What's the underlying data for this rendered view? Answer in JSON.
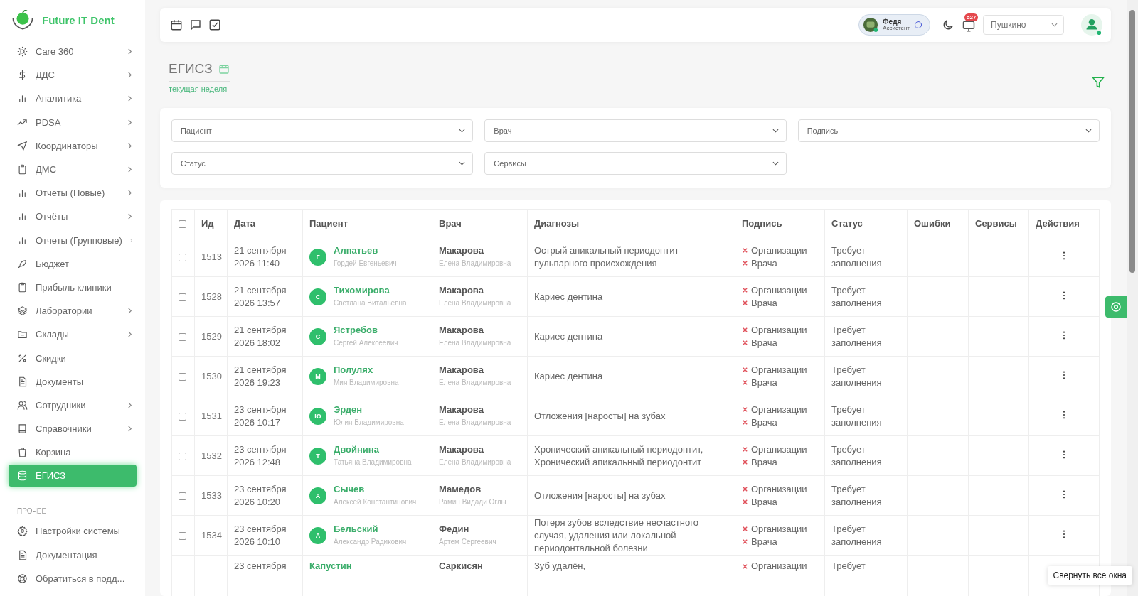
{
  "brand": "Future IT Dent",
  "sidebar": {
    "items": [
      {
        "label": "Care 360",
        "expandable": true,
        "selected": false
      },
      {
        "label": "ДДС",
        "expandable": true,
        "selected": false
      },
      {
        "label": "Аналитика",
        "expandable": true,
        "selected": false
      },
      {
        "label": "PDSA",
        "expandable": true,
        "selected": false
      },
      {
        "label": "Координаторы",
        "expandable": true,
        "selected": false
      },
      {
        "label": "ДМС",
        "expandable": true,
        "selected": false
      },
      {
        "label": "Отчеты (Новые)",
        "expandable": true,
        "selected": false
      },
      {
        "label": "Отчёты",
        "expandable": true,
        "selected": false
      },
      {
        "label": "Отчеты (Групповые)",
        "expandable": true,
        "selected": false
      },
      {
        "label": "Бюджет",
        "expandable": false,
        "selected": false
      },
      {
        "label": "Прибыль клиники",
        "expandable": false,
        "selected": false
      },
      {
        "label": "Лаборатории",
        "expandable": true,
        "selected": false
      },
      {
        "label": "Склады",
        "expandable": true,
        "selected": false
      },
      {
        "label": "Скидки",
        "expandable": false,
        "selected": false
      },
      {
        "label": "Документы",
        "expandable": false,
        "selected": false
      },
      {
        "label": "Сотрудники",
        "expandable": true,
        "selected": false
      },
      {
        "label": "Справочники",
        "expandable": true,
        "selected": false
      },
      {
        "label": "Корзина",
        "expandable": false,
        "selected": false
      },
      {
        "label": "ЕГИСЗ",
        "expandable": false,
        "selected": true
      }
    ],
    "section": "ПРОЧЕЕ",
    "other_items": [
      {
        "label": "Настройки системы"
      },
      {
        "label": "Документация"
      },
      {
        "label": "Обратиться в подд..."
      }
    ]
  },
  "topbar": {
    "assistant": {
      "name": "Федя",
      "role": "Ассистент"
    },
    "notifications": "527",
    "clinic": "Пушкино"
  },
  "page": {
    "title": "ЕГИСЗ",
    "period": "текущая неделя"
  },
  "filters": [
    {
      "placeholder": "Пациент"
    },
    {
      "placeholder": "Врач"
    },
    {
      "placeholder": "Подпись"
    },
    {
      "placeholder": "Статус"
    },
    {
      "placeholder": "Сервисы"
    }
  ],
  "table": {
    "all_checked": false,
    "columns": [
      "Ид",
      "Дата",
      "Пациент",
      "Врач",
      "Диагнозы",
      "Подпись",
      "Статус",
      "Ошибки",
      "Сервисы",
      "Действия"
    ],
    "rows": [
      {
        "checked": false,
        "id": "1513",
        "date": [
          "21 сентября",
          "2026 11:40"
        ],
        "initial": "Г",
        "patient": "Алпатьев",
        "patient_sub": "Гордей Евгеньевич",
        "doctor": "Макарова",
        "doctor_sub": "Елена Владимировна",
        "diagnosis": [
          "Острый апикальный периодонтит",
          "пульпарного происхождения"
        ],
        "signature": [
          "Организации",
          "Врача"
        ],
        "status": [
          "Требует",
          "заполнения"
        ]
      },
      {
        "checked": false,
        "id": "1528",
        "date": [
          "21 сентября",
          "2026 13:57"
        ],
        "initial": "С",
        "patient": "Тихомирова",
        "patient_sub": "Светлана Витальевна",
        "doctor": "Макарова",
        "doctor_sub": "Елена Владимировна",
        "diagnosis": [
          "Кариес дентина"
        ],
        "signature": [
          "Организации",
          "Врача"
        ],
        "status": [
          "Требует",
          "заполнения"
        ]
      },
      {
        "checked": false,
        "id": "1529",
        "date": [
          "21 сентября",
          "2026 18:02"
        ],
        "initial": "С",
        "patient": "Ястребов",
        "patient_sub": "Сергей Алексеевич",
        "doctor": "Макарова",
        "doctor_sub": "Елена Владимировна",
        "diagnosis": [
          "Кариес дентина"
        ],
        "signature": [
          "Организации",
          "Врача"
        ],
        "status": [
          "Требует",
          "заполнения"
        ]
      },
      {
        "checked": false,
        "id": "1530",
        "date": [
          "21 сентября",
          "2026 19:23"
        ],
        "initial": "М",
        "patient": "Полулях",
        "patient_sub": "Мия Владимировна",
        "doctor": "Макарова",
        "doctor_sub": "Елена Владимировна",
        "diagnosis": [
          "Кариес дентина"
        ],
        "signature": [
          "Организации",
          "Врача"
        ],
        "status": [
          "Требует",
          "заполнения"
        ]
      },
      {
        "checked": false,
        "id": "1531",
        "date": [
          "23 сентября",
          "2026 10:17"
        ],
        "initial": "Ю",
        "patient": "Эрден",
        "patient_sub": "Юлия Владимировна",
        "doctor": "Макарова",
        "doctor_sub": "Елена Владимировна",
        "diagnosis": [
          "Отложения [наросты] на зубах"
        ],
        "signature": [
          "Организации",
          "Врача"
        ],
        "status": [
          "Требует",
          "заполнения"
        ]
      },
      {
        "checked": false,
        "id": "1532",
        "date": [
          "23 сентября",
          "2026 12:48"
        ],
        "initial": "Т",
        "patient": "Двойнина",
        "patient_sub": "Татьяна Владимировна",
        "doctor": "Макарова",
        "doctor_sub": "Елена Владимировна",
        "diagnosis": [
          "Хронический апикальный периодонтит,",
          "Хронический апикальный периодонтит"
        ],
        "signature": [
          "Организации",
          "Врача"
        ],
        "status": [
          "Требует",
          "заполнения"
        ]
      },
      {
        "checked": false,
        "id": "1533",
        "date": [
          "23 сентября",
          "2026 10:20"
        ],
        "initial": "А",
        "patient": "Сычев",
        "patient_sub": "Алексей Константинович",
        "doctor": "Мамедов",
        "doctor_sub": "Рамин Видади Оглы",
        "diagnosis": [
          "Отложения [наросты] на зубах"
        ],
        "signature": [
          "Организации",
          "Врача"
        ],
        "status": [
          "Требует",
          "заполнения"
        ]
      },
      {
        "checked": false,
        "id": "1534",
        "date": [
          "23 сентября",
          "2026 10:10"
        ],
        "initial": "А",
        "patient": "Бельский",
        "patient_sub": "Александр Радикович",
        "doctor": "Федин",
        "doctor_sub": "Артем Сергеевич",
        "diagnosis": [
          "Потеря зубов вследствие несчастного",
          "случая, удаления или локальной",
          "периодонтальной болезни"
        ],
        "signature": [
          "Организации",
          "Врача"
        ],
        "status": [
          "Требует",
          "заполнения"
        ]
      },
      {
        "date": [
          "23 сентября"
        ],
        "patient": "Капустин",
        "doctor": "Саркисян",
        "diagnosis": [
          "Зуб удалён,"
        ],
        "signature": [
          "Организации"
        ],
        "status": [
          "Требует"
        ]
      }
    ]
  },
  "tooltip": "Свернуть все окна"
}
